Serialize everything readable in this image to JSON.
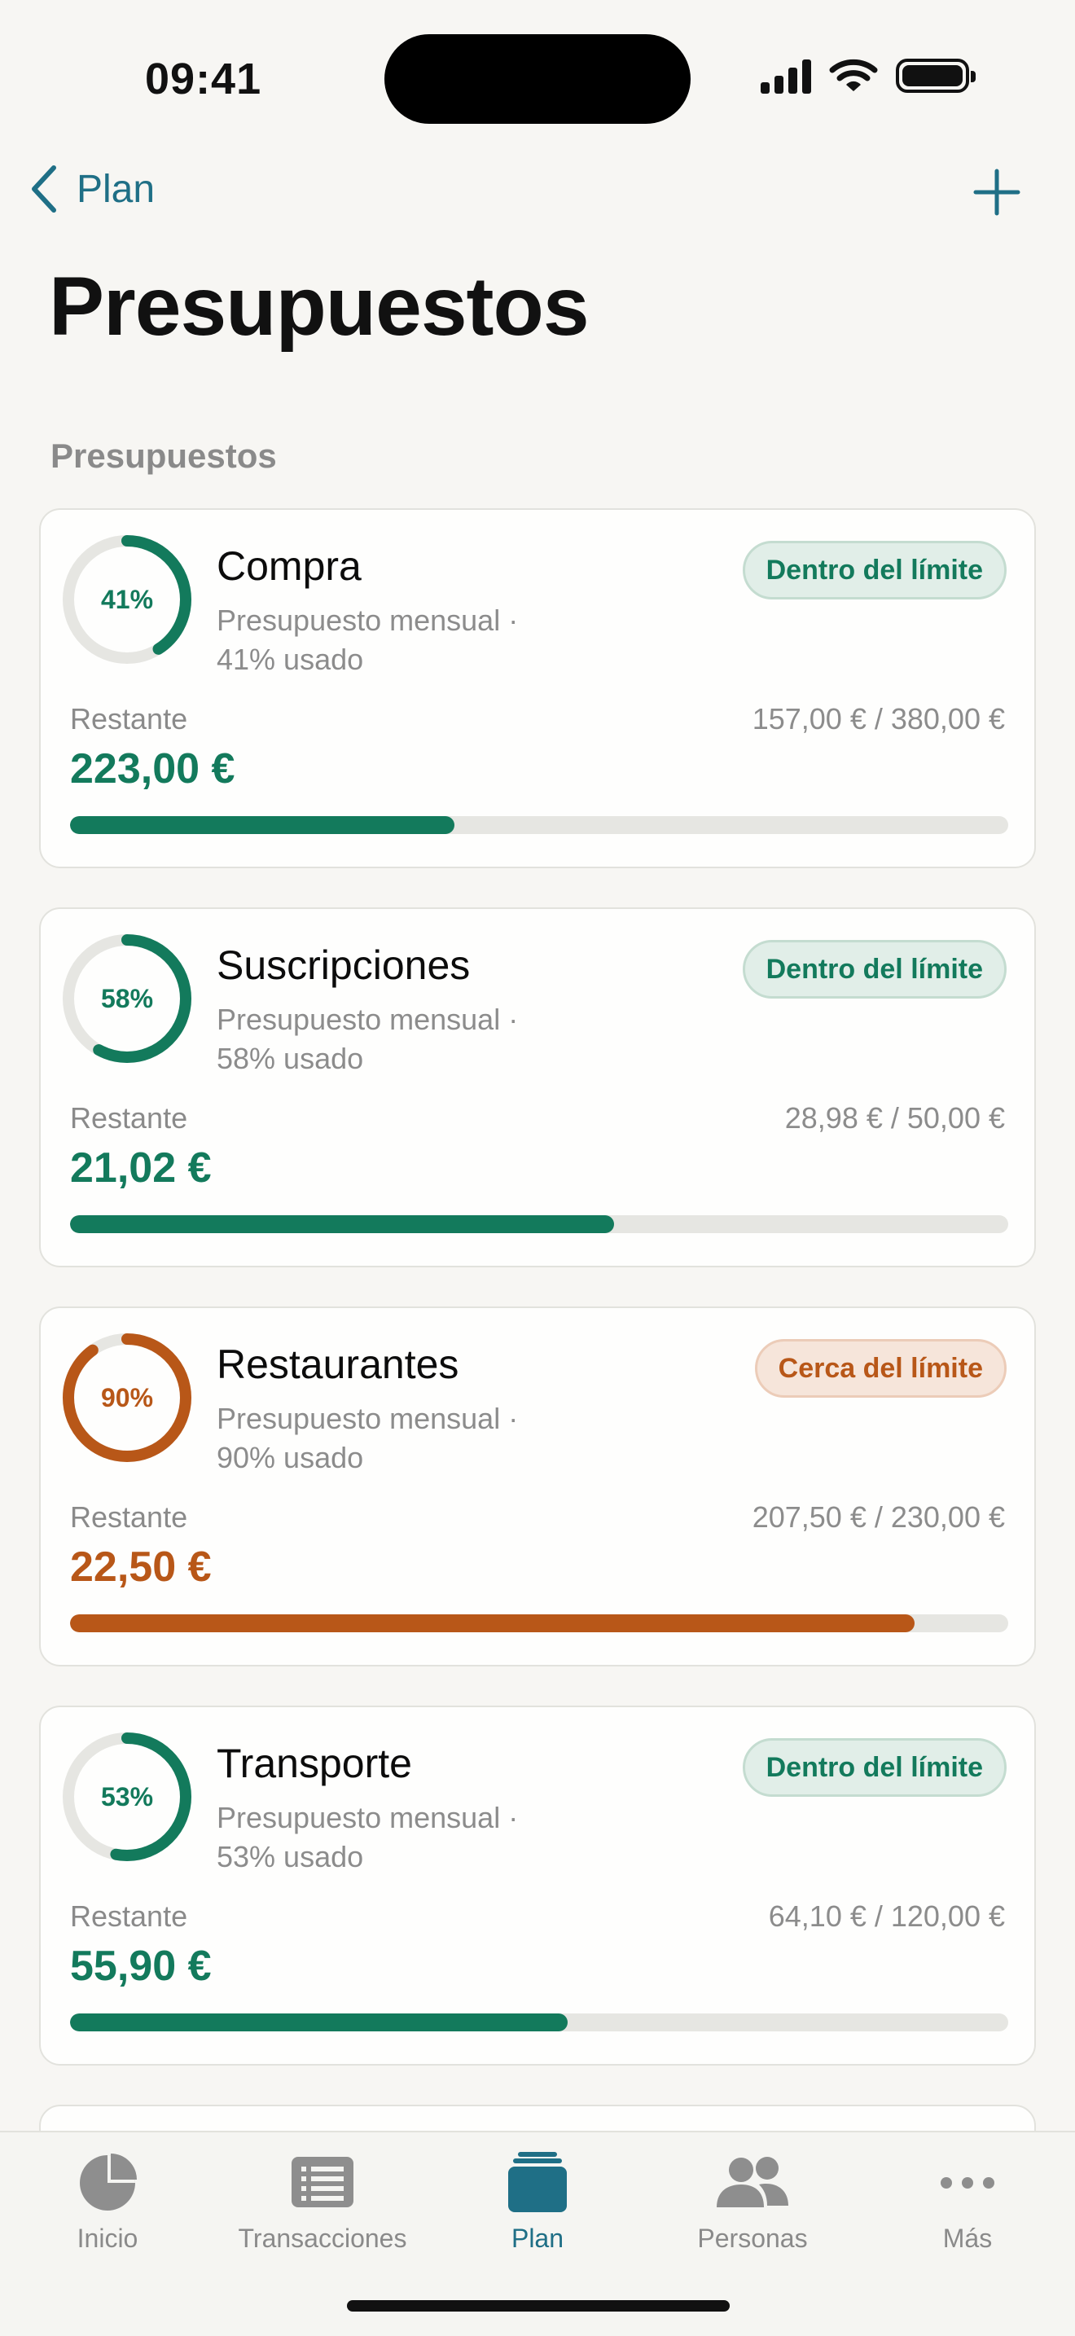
{
  "status": {
    "time": "09:41"
  },
  "nav": {
    "back_label": "Plan",
    "title": "Presupuestos"
  },
  "section_label": "Presupuestos",
  "colors": {
    "accent": "#1f6f86",
    "ok": "#137a5c",
    "warn": "#b85718",
    "track": "#e6e6e2"
  },
  "budgets": [
    {
      "name": "Compra",
      "ring_label": "41%",
      "usage": 0.41,
      "period": "Presupuesto mensual ·",
      "used_text": "41% usado",
      "badge": "Dentro del límite",
      "status": "ok",
      "remaining_label": "Restante",
      "remaining": "223,00 €",
      "spent_total": "157,00 € / 380,00 €"
    },
    {
      "name": "Suscripciones",
      "ring_label": "58%",
      "usage": 0.58,
      "period": "Presupuesto mensual ·",
      "used_text": "58% usado",
      "badge": "Dentro del límite",
      "status": "ok",
      "remaining_label": "Restante",
      "remaining": "21,02 €",
      "spent_total": "28,98 € / 50,00 €"
    },
    {
      "name": "Restaurantes",
      "ring_label": "90%",
      "usage": 0.9,
      "period": "Presupuesto mensual ·",
      "used_text": "90% usado",
      "badge": "Cerca del límite",
      "status": "warn",
      "remaining_label": "Restante",
      "remaining": "22,50 €",
      "spent_total": "207,50 € / 230,00 €"
    },
    {
      "name": "Transporte",
      "ring_label": "53%",
      "usage": 0.53,
      "period": "Presupuesto mensual ·",
      "used_text": "53% usado",
      "badge": "Dentro del límite",
      "status": "ok",
      "remaining_label": "Restante",
      "remaining": "55,90 €",
      "spent_total": "64,10 € / 120,00 €"
    }
  ],
  "tabs": [
    {
      "label": "Inicio",
      "icon": "pie-chart-icon",
      "active": false
    },
    {
      "label": "Transacciones",
      "icon": "list-icon",
      "active": false
    },
    {
      "label": "Plan",
      "icon": "folder-icon",
      "active": true
    },
    {
      "label": "Personas",
      "icon": "people-icon",
      "active": false
    },
    {
      "label": "Más",
      "icon": "more-icon",
      "active": false
    }
  ]
}
